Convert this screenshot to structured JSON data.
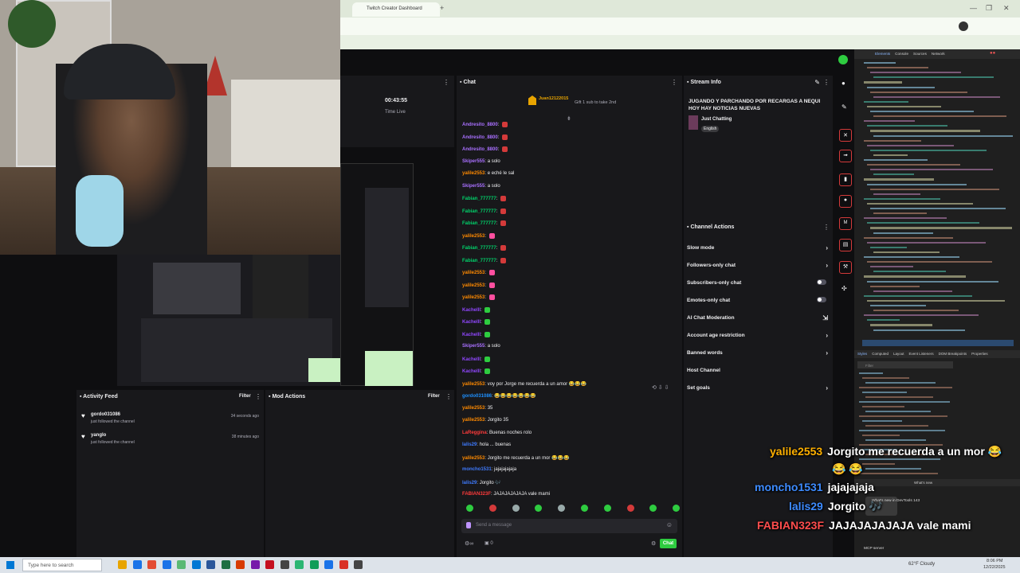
{
  "browser": {
    "tab_title": "Twitch Creator Dashboard",
    "window_controls": [
      "—",
      "❐",
      "✕"
    ]
  },
  "stream": {
    "session_time": "00:43:55",
    "status": "Time Live"
  },
  "chat": {
    "title": "Chat",
    "pinned_user": "Juan12122015",
    "pinned_text": "Gift 1 sub to take 2nd",
    "input_placeholder": "Send a message",
    "send_button": "Chat",
    "points": "0",
    "lines": [
      {
        "user": "Andresito_8800",
        "text": "",
        "color": "#a970ff",
        "emote": "#d43a3a"
      },
      {
        "user": "Andresito_8800",
        "text": "",
        "color": "#a970ff",
        "emote": "#d43a3a"
      },
      {
        "user": "Andresito_8800",
        "text": "",
        "color": "#a970ff",
        "emote": "#d43a3a"
      },
      {
        "user": "Skiper555",
        "text": "a solo",
        "color": "#a970ff",
        "emote": ""
      },
      {
        "user": "yalile2553",
        "text": "e eché le sal",
        "color": "#ff8a00",
        "emote": ""
      },
      {
        "user": "Skiper555",
        "text": "a solo",
        "color": "#a970ff",
        "emote": ""
      },
      {
        "user": "Fabian_777777",
        "text": "",
        "color": "#00d26a",
        "emote": "#d43a3a"
      },
      {
        "user": "Fabian_777777",
        "text": "",
        "color": "#00d26a",
        "emote": "#d43a3a"
      },
      {
        "user": "Fabian_777777",
        "text": "",
        "color": "#00d26a",
        "emote": "#d43a3a"
      },
      {
        "user": "yalile2553",
        "text": "",
        "color": "#ff8a00",
        "emote": "#ff4fa0"
      },
      {
        "user": "Fabian_777777",
        "text": "",
        "color": "#00d26a",
        "emote": "#d43a3a"
      },
      {
        "user": "Fabian_777777",
        "text": "",
        "color": "#00d26a",
        "emote": "#d43a3a"
      },
      {
        "user": "yalile2553",
        "text": "",
        "color": "#ff8a00",
        "emote": "#ff4fa0"
      },
      {
        "user": "yalile2553",
        "text": "",
        "color": "#ff8a00",
        "emote": "#ff4fa0"
      },
      {
        "user": "yalile2553",
        "text": "",
        "color": "#ff8a00",
        "emote": "#ff4fa0"
      },
      {
        "user": "Kachelll",
        "text": "",
        "color": "#9147ff",
        "emote": "#2ecc40"
      },
      {
        "user": "Kachelll",
        "text": "",
        "color": "#9147ff",
        "emote": "#2ecc40"
      },
      {
        "user": "Kachelll",
        "text": "",
        "color": "#9147ff",
        "emote": "#2ecc40"
      },
      {
        "user": "Skiper555",
        "text": "a solo",
        "color": "#a970ff",
        "emote": ""
      },
      {
        "user": "Kachelll",
        "text": "",
        "color": "#9147ff",
        "emote": "#2ecc40"
      },
      {
        "user": "Kachelll",
        "text": "",
        "color": "#9147ff",
        "emote": "#2ecc40"
      },
      {
        "user": "yalile2553",
        "text": "voy por Jorge me recuerda a un amor 😂😂😂",
        "color": "#ff8a00",
        "emote": ""
      },
      {
        "user": "gordo031086",
        "text": "😂😂😂😂😂😂😂",
        "color": "#1e90ff",
        "emote": ""
      },
      {
        "user": "yalile2553",
        "text": "35",
        "color": "#ff8a00",
        "emote": ""
      },
      {
        "user": "yalile2553",
        "text": "Jorgito 35",
        "color": "#ff8a00",
        "emote": ""
      },
      {
        "user": "LaReggina",
        "text": "Buenas noches rolo",
        "color": "#ff3b3b",
        "emote": ""
      },
      {
        "user": "lalis29",
        "text": "hola ... buenas",
        "color": "#3f7bff",
        "emote": ""
      },
      {
        "user": "yalile2553",
        "text": "Jorgito me recuerda a un mor 😂😂😂",
        "color": "#ff8a00",
        "emote": ""
      },
      {
        "user": "moncho1531",
        "text": "jajajajajaja",
        "color": "#3f7bff",
        "emote": ""
      },
      {
        "user": "lalis29",
        "text": "Jorgito 🎶",
        "color": "#3f7bff",
        "emote": ""
      },
      {
        "user": "FABIAN323F",
        "text": "JAJAJAJAJAJA vale mami",
        "color": "#ff3b3b",
        "emote": ""
      }
    ],
    "emote_bar_colors": [
      "#2ecc40",
      "#d43a3a",
      "#9aa",
      "#2ecc40",
      "#9aa",
      "#2ecc40",
      "#2ecc40",
      "#d43a3a",
      "#2ecc40",
      "#2ecc40"
    ]
  },
  "stream_info": {
    "title": "Stream Info",
    "stream_title": "JUGANDO Y PARCHANDO POR RECARGAS A NEQUI HOY HAY NOTICIAS NUEVAS",
    "category": "Just Chatting",
    "language": "English"
  },
  "channel_actions": {
    "title": "Channel Actions",
    "items": [
      {
        "label": "Slow mode",
        "control": "chevron"
      },
      {
        "label": "Followers-only chat",
        "control": "chevron"
      },
      {
        "label": "Subscribers-only chat",
        "control": "toggle"
      },
      {
        "label": "Emotes-only chat",
        "control": "toggle"
      },
      {
        "label": "AI Chat Moderation",
        "control": "external"
      },
      {
        "label": "Account age restriction",
        "control": "chevron"
      },
      {
        "label": "Banned words",
        "control": "chevron"
      },
      {
        "label": "Host Channel",
        "control": "none"
      },
      {
        "label": "Set goals",
        "control": "chevron"
      }
    ]
  },
  "activity_feed": {
    "title": "Activity Feed",
    "filter": "Filter",
    "items": [
      {
        "user": "gordo031086",
        "action": "just followed the channel",
        "time": "34 seconds ago"
      },
      {
        "user": "yanglo",
        "action": "just followed the channel",
        "time": "38 minutes ago"
      }
    ]
  },
  "mod_actions": {
    "title": "Mod Actions",
    "filter": "Filter"
  },
  "overlay_chat": [
    {
      "user": "yalile2553",
      "text": "Jorgito me recuerda a un mor 😂",
      "color": "#ffb000"
    },
    {
      "user": "",
      "text": "😂 😂",
      "color": "#ffb000"
    },
    {
      "user": "moncho1531",
      "text": "jajajajaja",
      "color": "#3d8bff"
    },
    {
      "user": "lalis29",
      "text": "Jorgito 🎶",
      "color": "#3d8bff"
    },
    {
      "user": "FABIAN323F",
      "text": "JAJAJAJAJAJA vale mami",
      "color": "#ff4d4d"
    }
  ],
  "devtools": {
    "tabs": [
      "Elements",
      "Console",
      "Sources",
      "Network"
    ],
    "styles_tabs": [
      "Styles",
      "Computed",
      "Layout",
      "Event Listeners",
      "DOM Breakpoints",
      "Properties"
    ],
    "filter_placeholder": "Filter",
    "whats_new": "What's new in DevTools 143",
    "whats_new_tab": "What's new",
    "mcp": "MCP server"
  },
  "taskbar": {
    "search_placeholder": "Type here to search",
    "weather": "62°F Cloudy",
    "time": "8:06 PM",
    "date": "12/22/2025",
    "icon_colors": [
      "#e8a400",
      "#1a73e8",
      "#e34b33",
      "#1a73e8",
      "#5bb974",
      "#0078d4",
      "#2b579a",
      "#1d6f42",
      "#d83b01",
      "#7719aa",
      "#c50f1f",
      "#444",
      "#2bb673",
      "#0f9d58",
      "#1a73e8",
      "#d93025",
      "#444"
    ]
  }
}
